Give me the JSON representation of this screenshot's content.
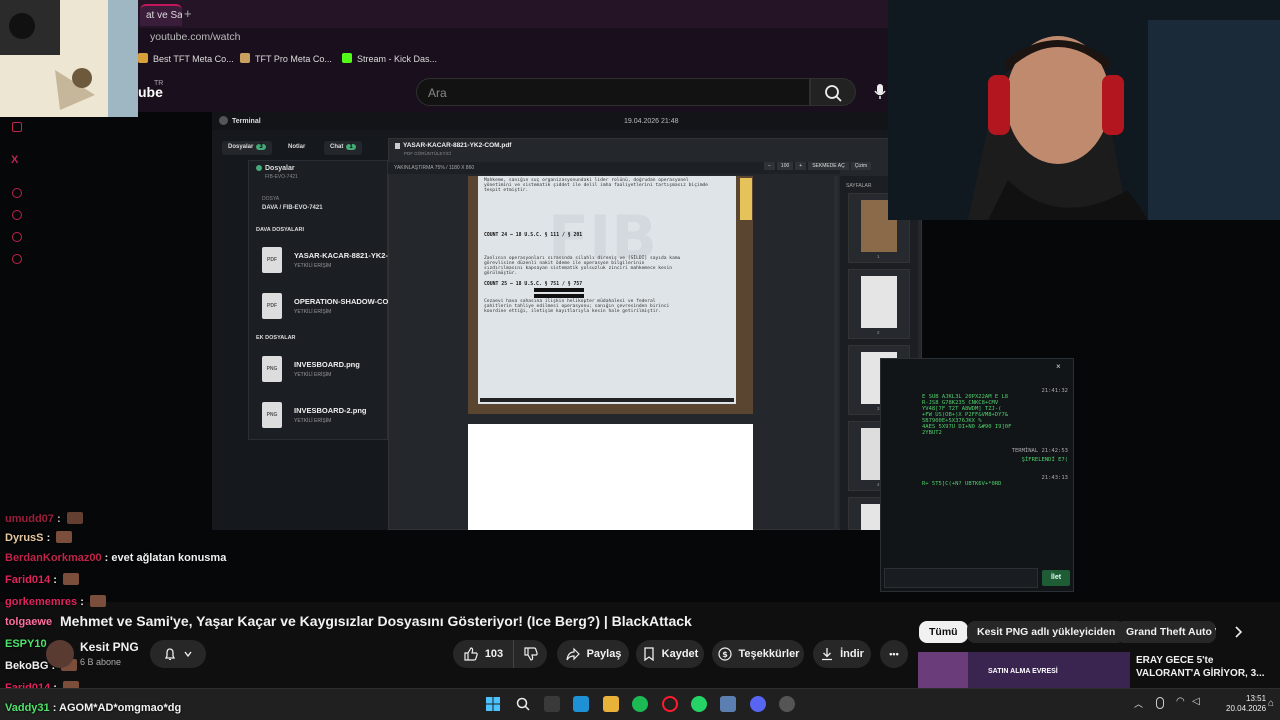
{
  "browser": {
    "tab_label": "at ve Sam",
    "new_tab": "+",
    "url": "youtube.com/watch",
    "bookmarks": [
      "Best TFT Meta Co...",
      "TFT Pro Meta Co...",
      "Stream - Kick Das..."
    ]
  },
  "youtube": {
    "logo": "ube",
    "region": "TR",
    "search_placeholder": "Ara",
    "video_title": "Mehmet ve Sami'ye, Yaşar Kaçar ve Kaygısızlar Dosyasını Gösteriyor! (Ice Berg?) | BlackAttack",
    "channel_name": "Kesit PNG",
    "channel_subs": "6 B abone",
    "likes": "103",
    "share_label": "Paylaş",
    "save_label": "Kaydet",
    "thanks_label": "Teşekkürler",
    "download_label": "İndir",
    "more_label": "•••",
    "chips": [
      "Tümü",
      "Kesit PNG adlı yükleyiciden",
      "Grand Theft Auto V"
    ],
    "rec_title": "ERAY GECE 5'te VALORANT'A GİRİYOR, 3...",
    "rec_thumb_text": "SATIN ALMA EVRESİ"
  },
  "terminal": {
    "title": "Terminal",
    "datetime": "19.04.2026 21:48",
    "chips": [
      {
        "label": "Dosyalar",
        "count": "3"
      },
      {
        "label": "Notlar",
        "count": ""
      },
      {
        "label": "Chat",
        "count": "1"
      }
    ],
    "files_title": "Dosyalar",
    "files_sub": "FIB-EVO-7421",
    "case_label": "DOSYA",
    "case_id": "DAVA / FIB-EVO-7421",
    "section_case": "DAVA DOSYALARI",
    "section_extra": "EK DOSYALAR",
    "files": [
      {
        "type": "PDF",
        "name": "YASAR-KACAR-8821-YK2-",
        "access": "YETKİLİ ERİŞİM"
      },
      {
        "type": "PDF",
        "name": "OPERATION-SHADOW-CO",
        "access": "YETKİLİ ERİŞİM"
      },
      {
        "type": "PNG",
        "name": "INVESBOARD.png",
        "access": "YETKİLİ ERİŞİM"
      },
      {
        "type": "PNG",
        "name": "INVESBOARD-2.png",
        "access": "YETKİLİ ERİŞİM"
      }
    ],
    "pdf_name": "YASAR-KACAR-8821-YK2-COM.pdf",
    "pdf_sub": "PDF GÖRÜNTÜLEYİCİ",
    "pdf_zoom": "YAKINLAŞTIRMA 75% / 1180 X 860",
    "pdf_controls": [
      "−",
      "100",
      "+",
      "SEKMEDE AÇ",
      "Çizim"
    ],
    "pages_title": "SAYFALAR",
    "page_numbers": [
      "1",
      "2",
      "3",
      "4"
    ],
    "doc_lines": [
      "Mahkeme, sanığın suç organizasyonundaki lider rolünü, doğrudan operasyonel",
      "yönetimini ve sistematik şiddet ile delil imha faaliyetlerini tartışmasız biçimde",
      "tespit etmiştir.",
      "COUNT 24 — 18 U.S.C. § 111 / § 201",
      "Zanlının operasyonları sırasında silahlı direniş ve [SİLDİ] sayıda kamu",
      "görevlisine düzenli nakit ödeme ile operasyon bilgilerinin",
      "sızdırılmasını kapsayan sistematik yolsuzluk zinciri mahkemece kesin",
      "görülmüştür.",
      "COUNT 25 — 18 U.S.C. § 751 / § 757",
      "Cezaevi hava sahasına ilişkin helikopter müdahalesi ve federal",
      "şahitlerin tahliye edilmesi operasyonu; sanığın çevresinden birinci",
      "koordine ettiği, iletişim kayıtlarıyla kesin hale getirilmiştir."
    ],
    "chat_lines": [
      {
        "time": "21:41:32",
        "text": "E SUB AJKL3L 20PX22AM E L8"
      },
      {
        "time": "",
        "text": "R-JS8 G78K235 CNKC8+CMV"
      },
      {
        "time": "",
        "text": "YV48[7F T2T A8WDM] TZJ-("
      },
      {
        "time": "",
        "text": "+FW US(OB+)X P2FF&VM8+DY7&"
      },
      {
        "time": "",
        "text": "5B7900E+5X376JKX %"
      },
      {
        "time": "",
        "text": "4AES  5X97U DI+N0 &#90 I9]0F"
      },
      {
        "time": "",
        "text": "2YBUT2"
      },
      {
        "time": "21:42:53",
        "text": "TERMİNAL"
      },
      {
        "time": "",
        "text": "ŞİFRELENDİ E7("
      },
      {
        "time": "21:43:13",
        "text": ""
      },
      {
        "time": "",
        "text": "R+ 5T5]C(+N? UBTK6V+*0RD"
      }
    ],
    "send_label": "İlet",
    "close_label": "×"
  },
  "stream_chat": [
    {
      "user": "umudd07",
      "text": "",
      "color": "#c0244a",
      "emote": true
    },
    {
      "user": "DyrusS",
      "text": "",
      "color": "#e8c9a0",
      "emote": true
    },
    {
      "user": "BerdanKorkmaz00",
      "text": "evet ağlatan konusma",
      "color": "#c0244a",
      "emote": false
    },
    {
      "user": "Farid014",
      "text": "",
      "color": "#e0245e",
      "emote": true
    },
    {
      "user": "gorkememres",
      "text": "",
      "color": "#e0245e",
      "emote": true
    },
    {
      "user": "tolgaewe",
      "text": "",
      "color": "#ff6fa0",
      "emote": true
    },
    {
      "user": "ESPY10",
      "text": "",
      "color": "#4ee36a",
      "emote": true
    },
    {
      "user": "BekoBG",
      "text": "",
      "color": "#f1f1f1",
      "emote": true
    },
    {
      "user": "Farid014",
      "text": "",
      "color": "#e0245e",
      "emote": true
    },
    {
      "user": "Vaddy31",
      "text": "AGOM*AD*omgmao*dg",
      "color": "#4ee36a",
      "emote": false
    }
  ],
  "taskbar": {
    "time": "13:51",
    "date": "20.04.2026"
  },
  "colors": {
    "accent": "#c0244a",
    "terminal_green": "#4ecf6a"
  }
}
